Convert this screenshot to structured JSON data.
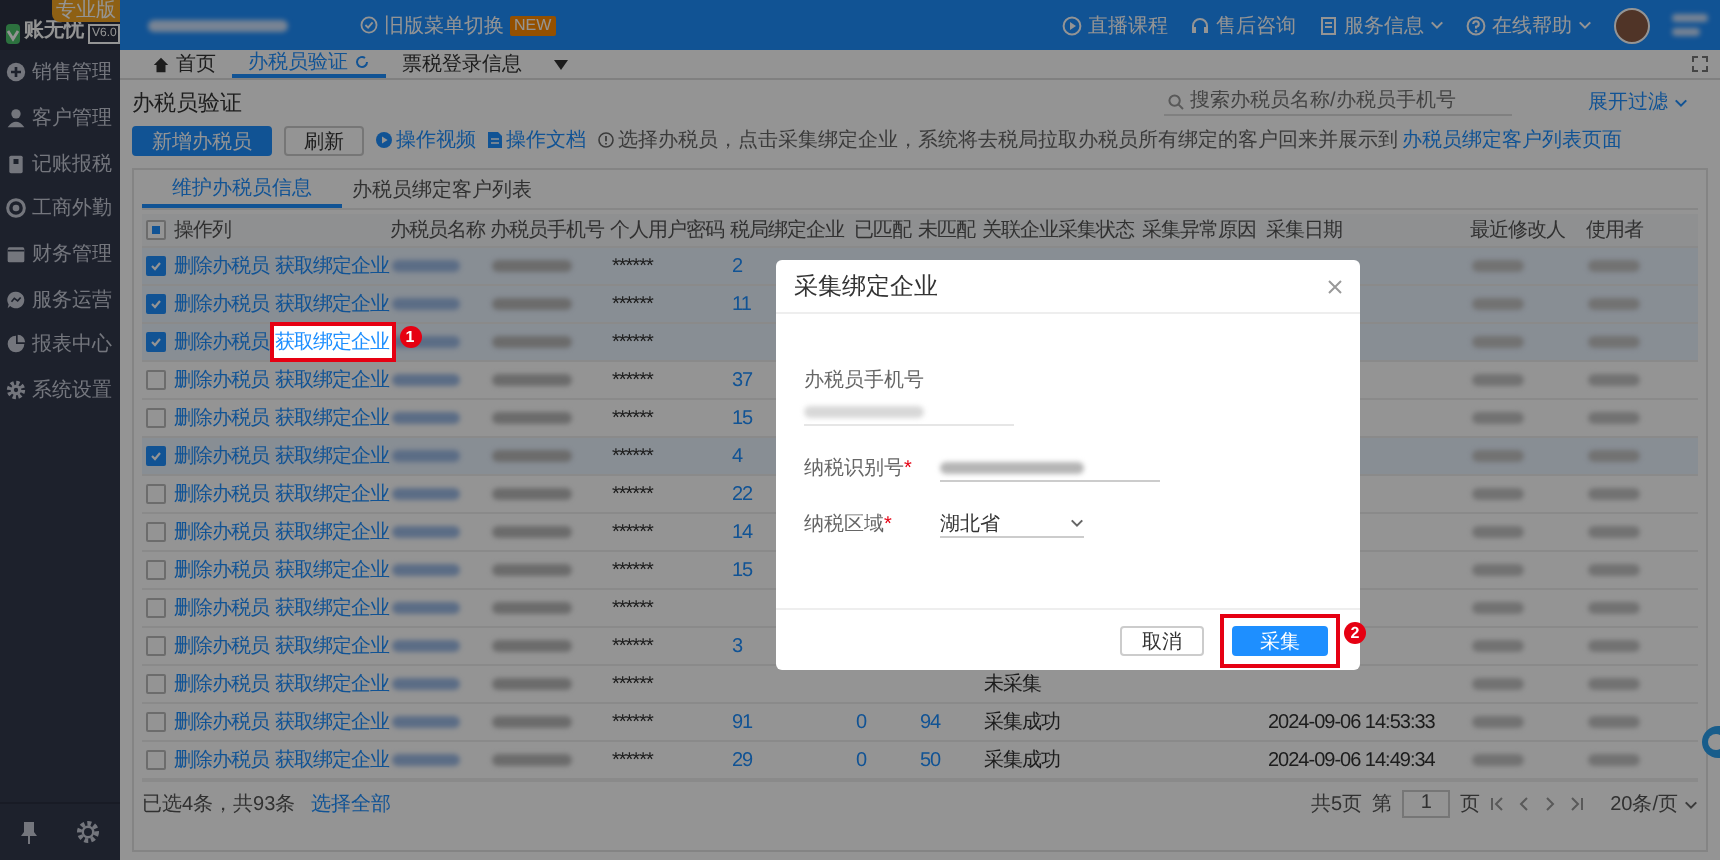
{
  "app": {
    "logo": "账无忧",
    "version": "V6.0",
    "edition": "专业版"
  },
  "topbar": {
    "menu_switch": "旧版菜单切换",
    "new_badge": "NEW",
    "links": [
      {
        "label": "直播课程",
        "dropdown": false
      },
      {
        "label": "售后咨询",
        "dropdown": false
      },
      {
        "label": "服务信息",
        "dropdown": true
      },
      {
        "label": "在线帮助",
        "dropdown": true
      }
    ]
  },
  "sidebar": {
    "items": [
      "销售管理",
      "客户管理",
      "记账报税",
      "工商外勤",
      "财务管理",
      "服务运营",
      "报表中心",
      "系统设置"
    ]
  },
  "page_tabs": [
    {
      "label": "首页",
      "selected": false
    },
    {
      "label": "办税员验证",
      "selected": true
    },
    {
      "label": "票税登录信息",
      "selected": false
    }
  ],
  "page": {
    "title": "办税员验证",
    "search": {
      "placeholder": "搜索办税员名称/办税员手机号"
    },
    "filter_toggle": "展开过滤",
    "buttons": [
      {
        "label": "新增办税员",
        "kind": "primary"
      },
      {
        "label": "刷新",
        "kind": "default"
      }
    ],
    "help_links": [
      "操作视频",
      "操作文档"
    ],
    "hint": "选择办税员，点击采集绑定企业，系统将去税局拉取办税员所有绑定的客户回来并展示到",
    "hint_link": "办税员绑定客户列表页面"
  },
  "sub_tabs": [
    {
      "label": "维护办税员信息",
      "selected": true
    },
    {
      "label": "办税员绑定客户列表",
      "selected": false
    }
  ],
  "table": {
    "indeterminate": true,
    "columns": [
      "操作列",
      "办税员名称",
      "办税员手机号",
      "个人用户密码",
      "税局绑定企业",
      "已匹配",
      "未匹配",
      "关联企业采集状态",
      "采集异常原因",
      "采集日期",
      "最近修改人",
      "使用者"
    ],
    "rows": [
      {
        "checked": true,
        "actions": [
          "删除办税员",
          "获取绑定企业"
        ],
        "password": "******",
        "bound": "2"
      },
      {
        "checked": true,
        "actions": [
          "删除办税员",
          "获取绑定企业"
        ],
        "password": "******",
        "bound": "11"
      },
      {
        "checked": true,
        "actions": [
          "删除办税员",
          "获取绑定企业"
        ],
        "password": "******",
        "callout": "1"
      },
      {
        "checked": false,
        "actions": [
          "删除办税员",
          "获取绑定企业"
        ],
        "password": "******",
        "bound": "37"
      },
      {
        "checked": false,
        "actions": [
          "删除办税员",
          "获取绑定企业"
        ],
        "password": "******",
        "bound": "15"
      },
      {
        "checked": true,
        "actions": [
          "删除办税员",
          "获取绑定企业"
        ],
        "password": "******",
        "bound": "4"
      },
      {
        "checked": false,
        "actions": [
          "删除办税员",
          "获取绑定企业"
        ],
        "password": "******",
        "bound": "22"
      },
      {
        "checked": false,
        "actions": [
          "删除办税员",
          "获取绑定企业"
        ],
        "password": "******",
        "bound": "14"
      },
      {
        "checked": false,
        "actions": [
          "删除办税员",
          "获取绑定企业"
        ],
        "password": "******",
        "bound": "15"
      },
      {
        "checked": false,
        "actions": [
          "删除办税员",
          "获取绑定企业"
        ],
        "password": "******"
      },
      {
        "checked": false,
        "actions": [
          "删除办税员",
          "获取绑定企业"
        ],
        "password": "******",
        "bound": "3"
      },
      {
        "checked": false,
        "actions": [
          "删除办税员",
          "获取绑定企业"
        ],
        "password": "******",
        "status": "未采集"
      },
      {
        "checked": false,
        "actions": [
          "删除办税员",
          "获取绑定企业"
        ],
        "password": "******",
        "bound": "91",
        "matched": "0",
        "unmatched": "94",
        "status": "采集成功",
        "date": "2024-09-06 14:53:33"
      },
      {
        "checked": false,
        "actions": [
          "删除办税员",
          "获取绑定企业"
        ],
        "password": "******",
        "bound": "29",
        "matched": "0",
        "unmatched": "50",
        "status": "采集成功",
        "date": "2024-09-06 14:49:34"
      }
    ]
  },
  "footer": {
    "selection": "已选4条，共93条",
    "select_all": "选择全部",
    "pages": "共5页",
    "page_prefix": "第",
    "page": "1",
    "page_suffix": "页",
    "page_size": "20条/页"
  },
  "modal": {
    "title": "采集绑定企业",
    "fields": [
      {
        "label": "办税员手机号",
        "kind": "readonly"
      },
      {
        "label": "纳税识别号",
        "kind": "text",
        "required_mark": "*"
      },
      {
        "label": "纳税区域",
        "kind": "select",
        "required_mark": "*",
        "value": "湖北省"
      }
    ],
    "buttons": [
      {
        "label": "取消",
        "kind": "default"
      },
      {
        "label": "采集",
        "kind": "primary",
        "callout": "2"
      }
    ]
  }
}
